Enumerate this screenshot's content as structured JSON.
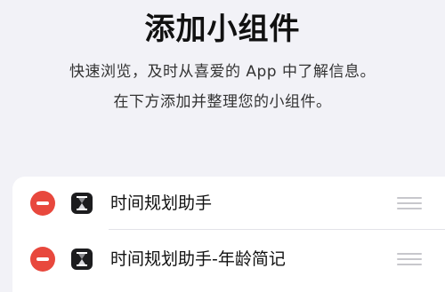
{
  "header": {
    "title": "添加小组件",
    "description_line1": "快速浏览，及时从喜爱的 App 中了解信息。",
    "description_line2": "在下方添加并整理您的小组件。"
  },
  "widgets": [
    {
      "label": "时间规划助手",
      "icon": "hourglass-icon"
    },
    {
      "label": "时间规划助手-年龄简记",
      "icon": "hourglass-icon"
    }
  ],
  "colors": {
    "background": "#f2f2f7",
    "card": "#ffffff",
    "remove_button": "#e8483d",
    "app_icon": "#1c1c1e",
    "drag_handle": "#c7c7cc"
  }
}
